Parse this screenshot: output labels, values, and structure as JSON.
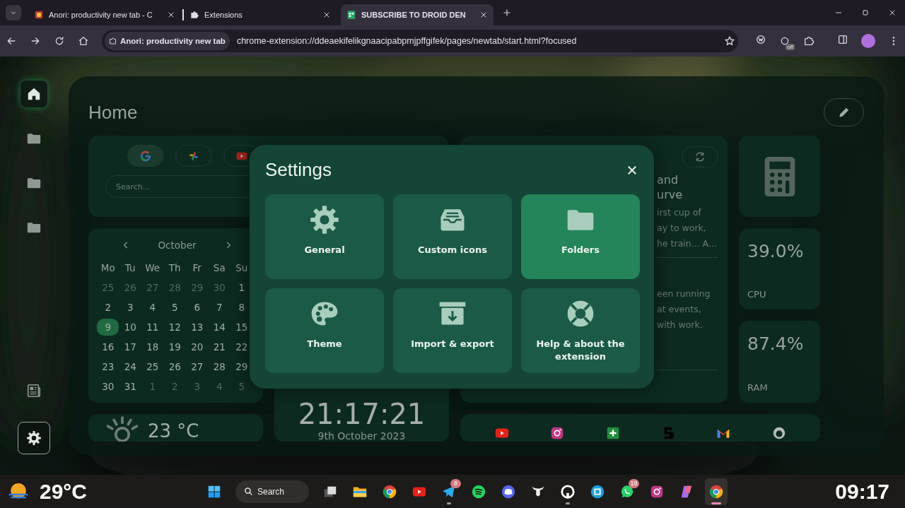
{
  "browser": {
    "tabs": [
      {
        "title": "Anori: productivity new tab - C",
        "kind": "palette",
        "selected": false
      },
      {
        "title": "Extensions",
        "kind": "puzzle",
        "selected": false
      },
      {
        "title": "SUBSCRIBE TO DROID DEN",
        "kind": "sheet",
        "selected": true
      }
    ],
    "site_chip": "Anori: productivity new tab",
    "url": "chrome-extension://ddeaekifelikgnaacipabpmjpffgifek/pages/newtab/start.html?focused",
    "extension_badge": "off"
  },
  "sidebar": {
    "items": [
      {
        "kind": "home",
        "selected": true
      },
      {
        "kind": "folder",
        "selected": false
      },
      {
        "kind": "folder",
        "selected": false
      },
      {
        "kind": "folder",
        "selected": false
      }
    ],
    "bottom_items": [
      {
        "kind": "news",
        "selected": false
      },
      {
        "kind": "settings",
        "selected": true
      }
    ]
  },
  "page": {
    "title": "Home"
  },
  "search_widget": {
    "engines": [
      {
        "kind": "google",
        "selected": true
      },
      {
        "kind": "pinwheel",
        "selected": false
      },
      {
        "kind": "youtube",
        "selected": false
      }
    ],
    "placeholder": "Search..."
  },
  "calendar": {
    "month": "October",
    "weekdays": [
      "Mo",
      "Tu",
      "We",
      "Th",
      "Fr",
      "Sa",
      "Su"
    ],
    "days": [
      {
        "text": "25",
        "outside": true,
        "selected": false
      },
      {
        "text": "26",
        "outside": true,
        "selected": false
      },
      {
        "text": "27",
        "outside": true,
        "selected": false
      },
      {
        "text": "28",
        "outside": true,
        "selected": false
      },
      {
        "text": "29",
        "outside": true,
        "selected": false
      },
      {
        "text": "30",
        "outside": true,
        "selected": false
      },
      {
        "text": "1",
        "outside": false,
        "selected": false
      },
      {
        "text": "2",
        "outside": false,
        "selected": false
      },
      {
        "text": "3",
        "outside": false,
        "selected": false
      },
      {
        "text": "4",
        "outside": false,
        "selected": false
      },
      {
        "text": "5",
        "outside": false,
        "selected": false
      },
      {
        "text": "6",
        "outside": false,
        "selected": false
      },
      {
        "text": "7",
        "outside": false,
        "selected": false
      },
      {
        "text": "8",
        "outside": false,
        "selected": false
      },
      {
        "text": "9",
        "outside": false,
        "selected": true
      },
      {
        "text": "10",
        "outside": false,
        "selected": false
      },
      {
        "text": "11",
        "outside": false,
        "selected": false
      },
      {
        "text": "12",
        "outside": false,
        "selected": false
      },
      {
        "text": "13",
        "outside": false,
        "selected": false
      },
      {
        "text": "14",
        "outside": false,
        "selected": false
      },
      {
        "text": "15",
        "outside": false,
        "selected": false
      },
      {
        "text": "16",
        "outside": false,
        "selected": false
      },
      {
        "text": "17",
        "outside": false,
        "selected": false
      },
      {
        "text": "18",
        "outside": false,
        "selected": false
      },
      {
        "text": "19",
        "outside": false,
        "selected": false
      },
      {
        "text": "20",
        "outside": false,
        "selected": false
      },
      {
        "text": "21",
        "outside": false,
        "selected": false
      },
      {
        "text": "22",
        "outside": false,
        "selected": false
      },
      {
        "text": "23",
        "outside": false,
        "selected": false
      },
      {
        "text": "24",
        "outside": false,
        "selected": false
      },
      {
        "text": "25",
        "outside": false,
        "selected": false
      },
      {
        "text": "26",
        "outside": false,
        "selected": false
      },
      {
        "text": "27",
        "outside": false,
        "selected": false
      },
      {
        "text": "28",
        "outside": false,
        "selected": false
      },
      {
        "text": "29",
        "outside": false,
        "selected": false
      },
      {
        "text": "30",
        "outside": false,
        "selected": false
      },
      {
        "text": "31",
        "outside": false,
        "selected": false
      },
      {
        "text": "1",
        "outside": true,
        "selected": false
      },
      {
        "text": "2",
        "outside": true,
        "selected": false
      },
      {
        "text": "3",
        "outside": true,
        "selected": false
      },
      {
        "text": "4",
        "outside": true,
        "selected": false
      },
      {
        "text": "5",
        "outside": true,
        "selected": false
      }
    ]
  },
  "weather": {
    "temperature": "23 °C"
  },
  "clock": {
    "time": "21:17:21",
    "date": "9th October 2023"
  },
  "news": {
    "articles": [
      {
        "title_lines": [
          "and",
          "urve"
        ],
        "body_lines": [
          "irst cup of",
          "ay to work,",
          "he train... A..."
        ]
      },
      {
        "body_lines": [
          "een running",
          "at events,",
          "with work."
        ]
      }
    ]
  },
  "system": [
    {
      "value": "39.0%",
      "label": "CPU"
    },
    {
      "value": "87.4%",
      "label": "RAM"
    }
  ],
  "bookmarks": [
    {
      "kind": "youtube"
    },
    {
      "kind": "instagram"
    },
    {
      "kind": "plus"
    },
    {
      "kind": "five"
    },
    {
      "kind": "mail"
    },
    {
      "kind": "cat"
    }
  ],
  "settings": {
    "title": "Settings",
    "tiles": [
      {
        "kind": "gear",
        "label": "General",
        "selected": false
      },
      {
        "kind": "inbox",
        "label": "Custom icons",
        "selected": false
      },
      {
        "kind": "folder",
        "label": "Folders",
        "selected": true
      },
      {
        "kind": "palette",
        "label": "Theme",
        "selected": false
      },
      {
        "kind": "archive",
        "label": "Import & export",
        "selected": false
      },
      {
        "kind": "lifebuoy",
        "label": "Help & about the extension",
        "selected": false
      }
    ]
  },
  "taskbar": {
    "temperature": "29°C",
    "search": "Search",
    "time": "09:17",
    "apps": [
      {
        "kind": "windows",
        "running": false,
        "selected": false
      },
      {
        "kind": "taskview",
        "running": false,
        "selected": false
      },
      {
        "kind": "explorer",
        "running": false,
        "selected": false
      },
      {
        "kind": "chrome",
        "running": false,
        "selected": false
      },
      {
        "kind": "youtube",
        "running": false,
        "selected": false
      },
      {
        "kind": "telegram",
        "badge": "8",
        "running": true,
        "selected": false
      },
      {
        "kind": "spotify",
        "running": false,
        "selected": false
      },
      {
        "kind": "discord",
        "running": false,
        "selected": false
      },
      {
        "kind": "bull",
        "running": false,
        "selected": false
      },
      {
        "kind": "github",
        "running": true,
        "selected": false
      },
      {
        "kind": "bluebox",
        "running": false,
        "selected": false
      },
      {
        "kind": "whatsapp",
        "badge": "19",
        "running": false,
        "selected": false
      },
      {
        "kind": "instagram",
        "running": false,
        "selected": false
      },
      {
        "kind": "copilot",
        "running": false,
        "selected": false
      },
      {
        "kind": "chrome",
        "running": true,
        "selected": true
      }
    ]
  }
}
